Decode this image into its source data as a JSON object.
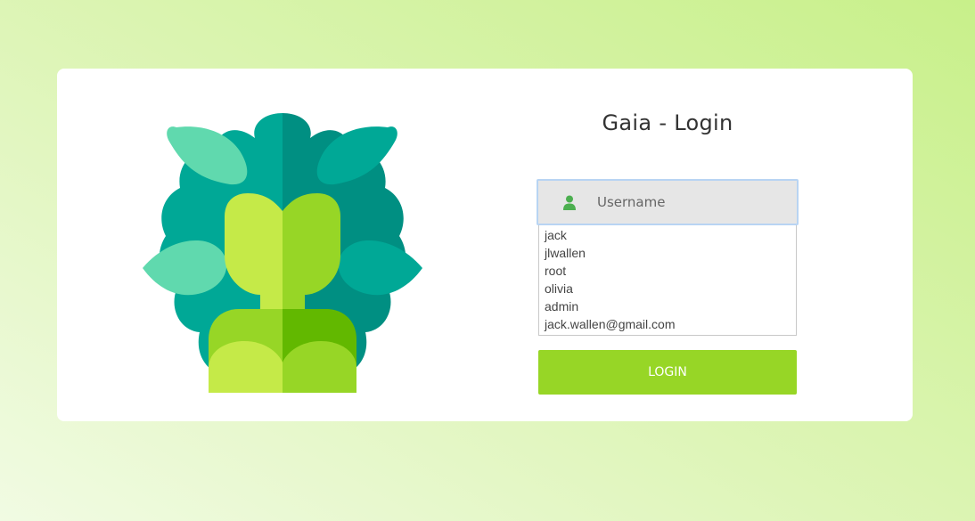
{
  "app": {
    "title": "Gaia - Login"
  },
  "login_form": {
    "username_placeholder": "Username",
    "user_icon": "user-icon",
    "autocomplete_suggestions": [
      "jack",
      "jlwallen",
      "root",
      "olivia",
      "admin",
      "jack.wallen@gmail.com"
    ],
    "login_button_label": "LOGIN"
  },
  "colors": {
    "background_gradient": [
      "#f1fbe3",
      "#c8f08a"
    ],
    "card": "#ffffff",
    "button": "#97d626",
    "user_icon": "#4caf50",
    "input_focus_border": "#b8d4f3"
  },
  "logo": {
    "name": "gaia-logo-icon"
  }
}
